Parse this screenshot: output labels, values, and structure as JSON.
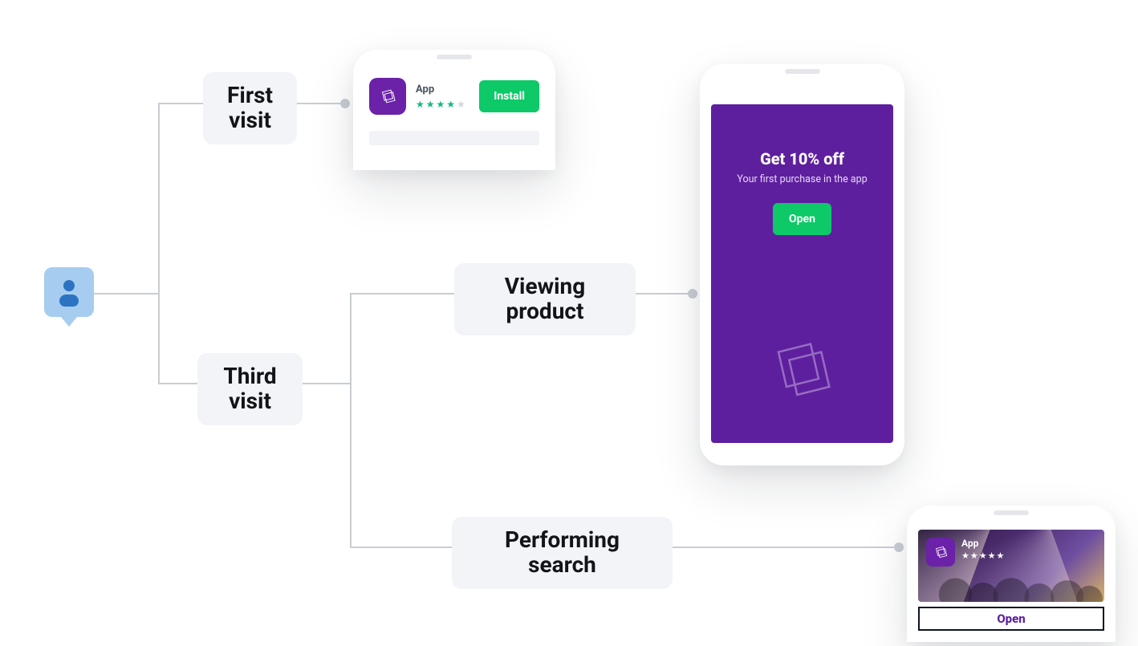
{
  "colors": {
    "accent_green": "#0dc968",
    "brand_purple": "#5e1f9e",
    "line": "#c9cdd4",
    "box_bg": "#f2f4f7",
    "user_bubble": "#a6cdf0",
    "user_fg": "#2d73c2"
  },
  "nodes": {
    "first_visit": {
      "line1": "First",
      "line2": "visit"
    },
    "third_visit": {
      "line1": "Third",
      "line2": "visit"
    },
    "viewing_product": {
      "line1": "Viewing",
      "line2": "product"
    },
    "performing_search": {
      "line1": "Performing",
      "line2": "search"
    }
  },
  "phones": {
    "install_card": {
      "app_name": "App",
      "rating_stars": 4,
      "rating_max": 5,
      "install_label": "Install",
      "icon_name": "ticket-icon"
    },
    "offer_screen": {
      "headline": "Get 10% off",
      "subline": "Your first purchase in the app",
      "open_label": "Open",
      "icon_name": "ticket-icon"
    },
    "search_banner": {
      "app_name": "App",
      "rating_stars": 5,
      "rating_max": 5,
      "open_label": "Open",
      "icon_name": "ticket-icon"
    }
  }
}
